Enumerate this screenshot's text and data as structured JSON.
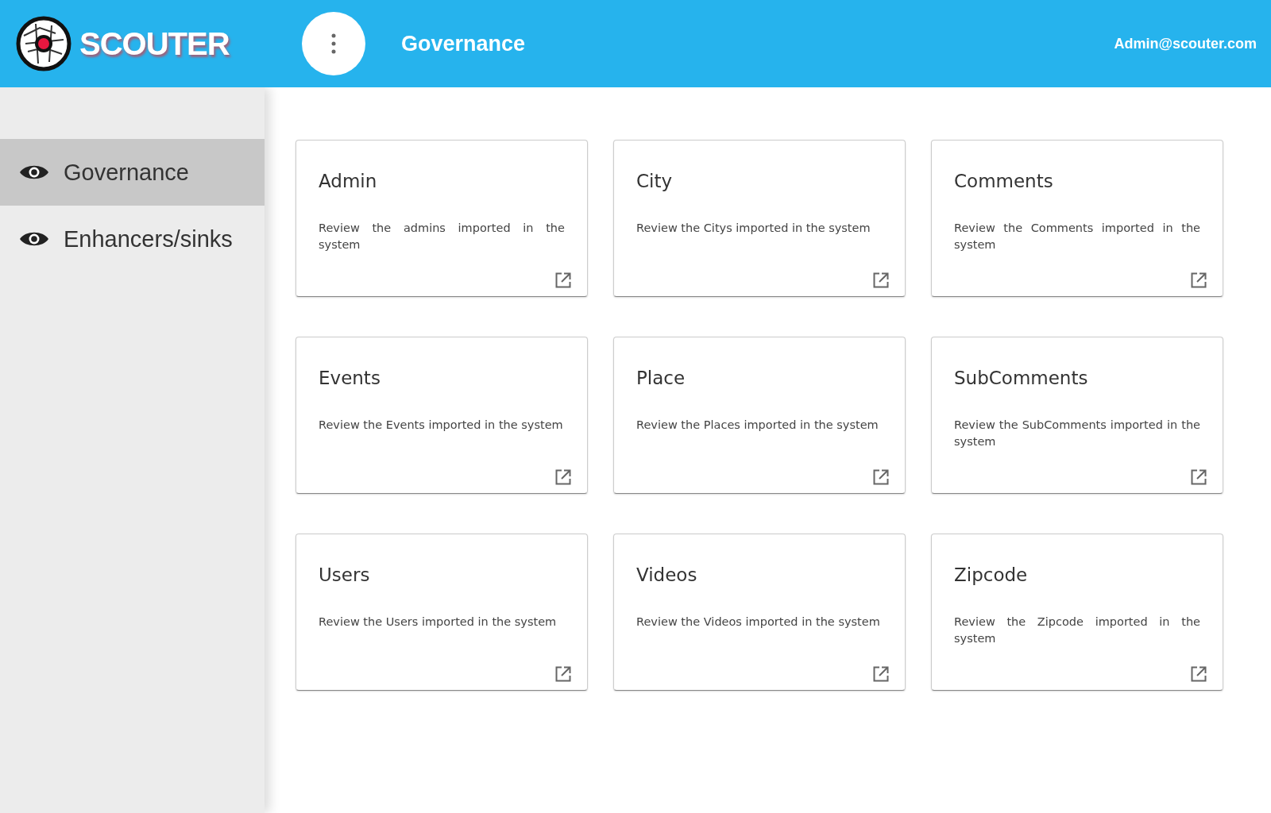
{
  "header": {
    "logo_text": "SCOUTER",
    "page_title": "Governance",
    "user": "Admin@scouter.com"
  },
  "sidebar": {
    "items": [
      {
        "label": "Governance",
        "selected": true
      },
      {
        "label": "Enhancers/sinks",
        "selected": false
      }
    ]
  },
  "cards": [
    {
      "title": "Admin",
      "description": "Review the admins imported in the system"
    },
    {
      "title": "City",
      "description": "Review the Citys imported in the system"
    },
    {
      "title": "Comments",
      "description": "Review the Comments imported in the system"
    },
    {
      "title": "Events",
      "description": "Review the Events imported in the system"
    },
    {
      "title": "Place",
      "description": "Review the Places imported in the system"
    },
    {
      "title": "SubComments",
      "description": "Review the SubComments imported in the system"
    },
    {
      "title": "Users",
      "description": "Review the Users imported in the system"
    },
    {
      "title": "Videos",
      "description": "Review the Videos imported in the system"
    },
    {
      "title": "Zipcode",
      "description": "Review the Zipcode imported in the system"
    }
  ]
}
